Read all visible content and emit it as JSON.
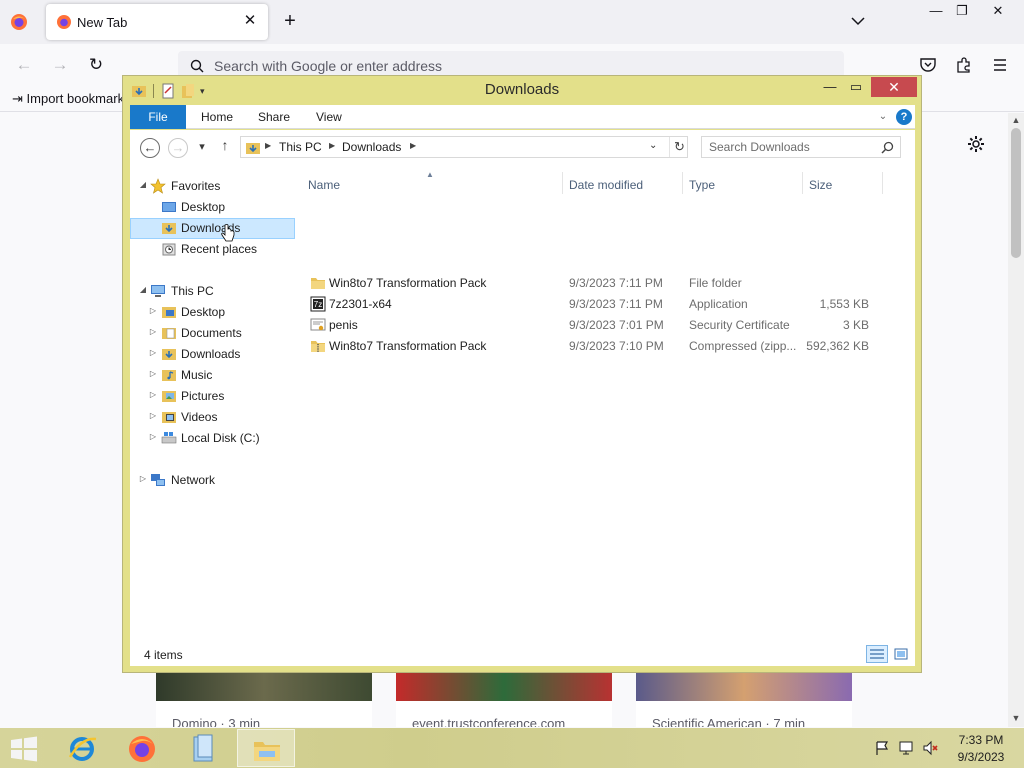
{
  "browser": {
    "tab_title": "New Tab",
    "tab_close": "✕",
    "new_tab": "+",
    "address_placeholder": "Search with Google or enter address",
    "import_bookmarks": "Import bookmarks...",
    "window_controls": {
      "minimize": "—",
      "restore": "❐",
      "close": "✕"
    },
    "cards": [
      {
        "source": "Domino · 3 min"
      },
      {
        "source": "event.trustconference.com"
      },
      {
        "source": "Scientific American · 7 min"
      }
    ]
  },
  "explorer": {
    "title": "Downloads",
    "ribbon_tabs": {
      "file": "File",
      "home": "Home",
      "share": "Share",
      "view": "View"
    },
    "help": "?",
    "breadcrumb": [
      "This PC",
      "Downloads"
    ],
    "search_placeholder": "Search Downloads",
    "nav_tree": {
      "favorites": {
        "label": "Favorites",
        "items": [
          {
            "label": "Desktop"
          },
          {
            "label": "Downloads",
            "selected": true
          },
          {
            "label": "Recent places"
          }
        ]
      },
      "this_pc": {
        "label": "This PC",
        "items": [
          {
            "label": "Desktop"
          },
          {
            "label": "Documents"
          },
          {
            "label": "Downloads"
          },
          {
            "label": "Music"
          },
          {
            "label": "Pictures"
          },
          {
            "label": "Videos"
          },
          {
            "label": "Local Disk (C:)"
          }
        ]
      },
      "network": {
        "label": "Network"
      }
    },
    "columns": {
      "name": "Name",
      "date": "Date modified",
      "type": "Type",
      "size": "Size"
    },
    "files": [
      {
        "name": "Win8to7 Transformation Pack",
        "date": "9/3/2023 7:11 PM",
        "type": "File folder",
        "size": "",
        "icon": "folder-icon"
      },
      {
        "name": "7z2301-x64",
        "date": "9/3/2023 7:11 PM",
        "type": "Application",
        "size": "1,553 KB",
        "icon": "application-icon"
      },
      {
        "name": "penis",
        "date": "9/3/2023 7:01 PM",
        "type": "Security Certificate",
        "size": "3 KB",
        "icon": "certificate-icon"
      },
      {
        "name": "Win8to7 Transformation Pack",
        "date": "9/3/2023 7:10 PM",
        "type": "Compressed (zipp...",
        "size": "592,362 KB",
        "icon": "zip-folder-icon"
      }
    ],
    "status": "4 items"
  },
  "taskbar": {
    "clock_time": "7:33 PM",
    "clock_date": "9/3/2023"
  },
  "colors": {
    "explorer_frame": "#e3e08a",
    "ribbon_file": "#1979ca",
    "close_button": "#c74a4f",
    "selection": "#cce8ff"
  }
}
